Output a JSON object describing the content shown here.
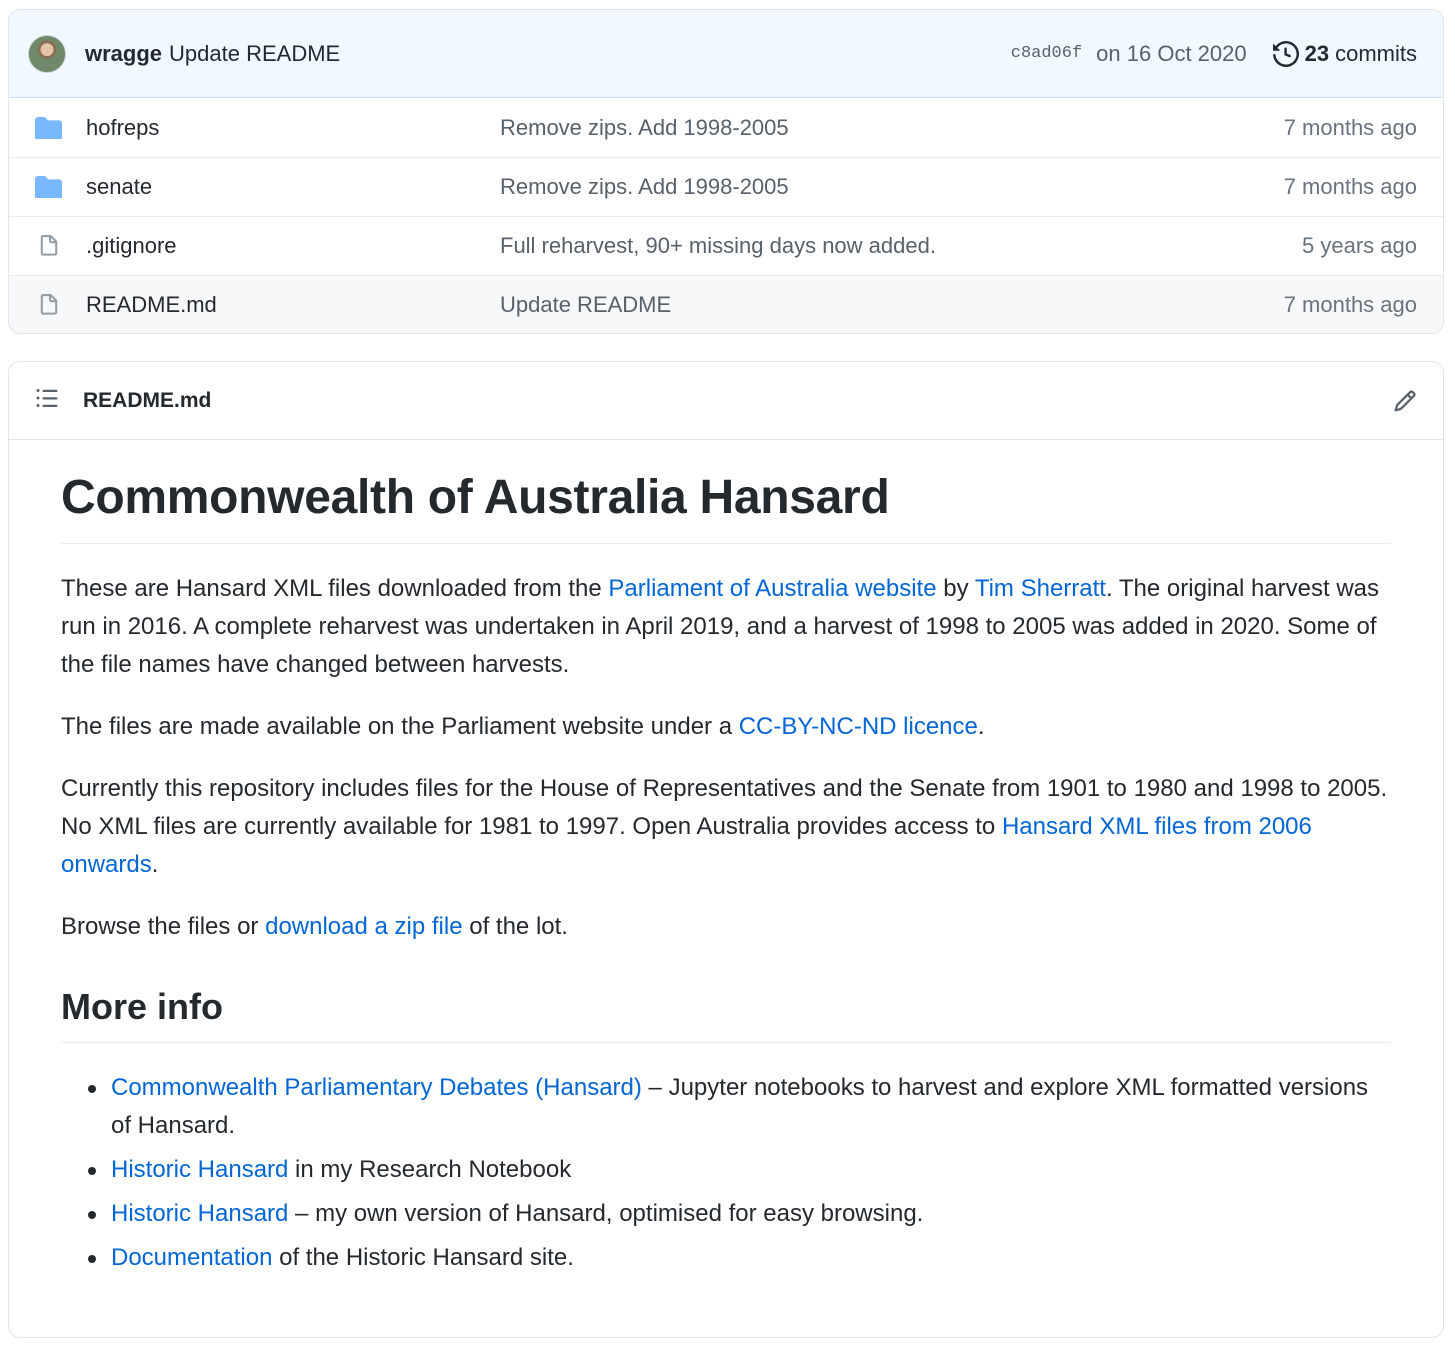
{
  "latest_commit": {
    "author": "wragge",
    "message": "Update README",
    "sha": "c8ad06f",
    "date": "on 16 Oct 2020",
    "commit_count": "23",
    "commit_label": "commits"
  },
  "files": [
    {
      "name": "hofreps",
      "type": "folder",
      "commit": "Remove zips. Add 1998-2005",
      "age": "7 months ago"
    },
    {
      "name": "senate",
      "type": "folder",
      "commit": "Remove zips. Add 1998-2005",
      "age": "7 months ago"
    },
    {
      "name": ".gitignore",
      "type": "file",
      "commit": "Full reharvest, 90+ missing days now added.",
      "age": "5 years ago"
    },
    {
      "name": "README.md",
      "type": "file",
      "commit": "Update README",
      "age": "7 months ago"
    }
  ],
  "readme": {
    "filename": "README.md",
    "title": "Commonwealth of Australia Hansard",
    "p1": {
      "t1": "These are Hansard XML files downloaded from the ",
      "link1": "Parliament of Australia website",
      "t2": " by ",
      "link2": "Tim Sherratt",
      "t3": ". The original harvest was run in 2016. A complete reharvest was undertaken in April 2019, and a harvest of 1998 to 2005 was added in 2020. Some of the file names have changed between harvests."
    },
    "p2": {
      "t1": "The files are made available on the Parliament website under a ",
      "link1": "CC-BY-NC-ND licence",
      "t2": "."
    },
    "p3": {
      "t1": "Currently this repository includes files for the House of Representatives and the Senate from 1901 to 1980 and 1998 to 2005. No XML files are currently available for 1981 to 1997. Open Australia provides access to ",
      "link1": "Hansard XML files from 2006 onwards",
      "t2": "."
    },
    "p4": {
      "t1": "Browse the files or ",
      "link1": "download a zip file",
      "t2": " of the lot."
    },
    "h2": "More info",
    "list": [
      {
        "link": "Commonwealth Parliamentary Debates (Hansard)",
        "text": " – Jupyter notebooks to harvest and explore XML formatted versions of Hansard."
      },
      {
        "link": "Historic Hansard",
        "text": " in my Research Notebook"
      },
      {
        "link": "Historic Hansard",
        "text": " – my own version of Hansard, optimised for easy browsing."
      },
      {
        "link": "Documentation",
        "text": " of the Historic Hansard site."
      }
    ]
  },
  "icons": {
    "folder": "folder-icon",
    "file": "file-icon",
    "history": "history-icon",
    "toc": "list-icon",
    "edit": "pencil-icon"
  },
  "colors": {
    "link": "#0366d6",
    "folder": "#79b8ff",
    "commit_bar_bg": "#f1f8ff"
  }
}
